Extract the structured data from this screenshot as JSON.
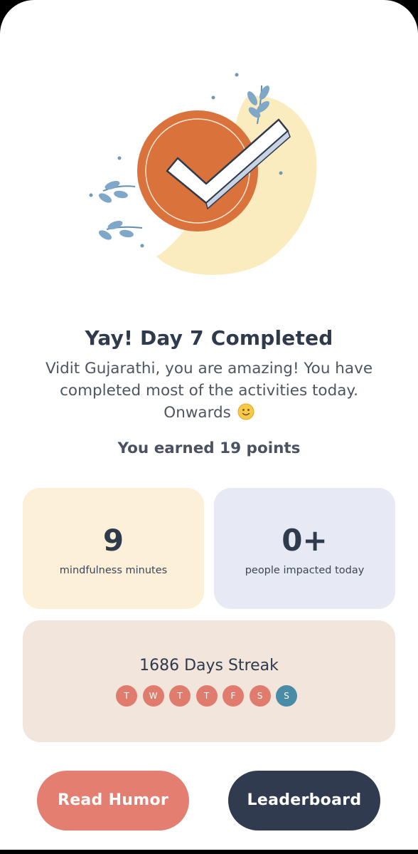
{
  "result": {
    "title": "Yay! Day 7 Completed",
    "message_line1": "Vidit Gujarathi, you are amazing! You have",
    "message_line2": "completed most of the activities today.",
    "message_line3": "Onwards",
    "points_text": "You earned 19 points"
  },
  "stats": {
    "minutes_value": "9",
    "minutes_label": "mindfulness minutes",
    "people_value": "0+",
    "people_label": "people impacted today"
  },
  "streak": {
    "title": "1686 Days Streak",
    "days": [
      "T",
      "W",
      "T",
      "T",
      "F",
      "S",
      "S"
    ]
  },
  "actions": {
    "read_humor": "Read Humor",
    "leaderboard": "Leaderboard"
  },
  "icons": {
    "illustration": "checkmark-badge-icon",
    "emoji": "slightly-smiling-face-icon"
  },
  "colors": {
    "accent": "#e37e70",
    "dark": "#303b4f",
    "streak_current": "#4a8ca8"
  }
}
